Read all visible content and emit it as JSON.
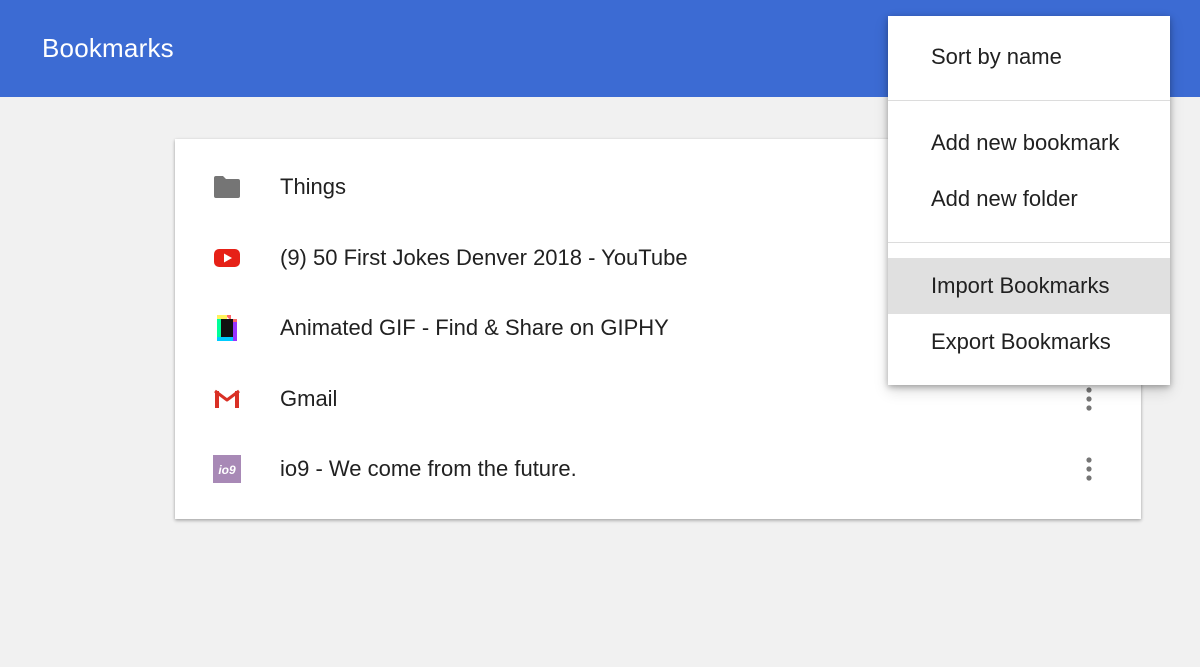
{
  "header": {
    "title": "Bookmarks",
    "background_color": "#3c6bd3"
  },
  "bookmarks": [
    {
      "title": "Things",
      "icon": "folder-icon",
      "type": "folder"
    },
    {
      "title": "(9) 50 First Jokes Denver 2018 - YouTube",
      "icon": "youtube-favicon"
    },
    {
      "title": "Animated GIF - Find & Share on GIPHY",
      "icon": "giphy-favicon"
    },
    {
      "title": "Gmail",
      "icon": "gmail-favicon"
    },
    {
      "title": "io9 - We come from the future.",
      "icon": "io9-favicon",
      "favicon_text": "io9"
    }
  ],
  "menu": {
    "items": [
      {
        "label": "Sort by name"
      },
      {
        "label": "Add new bookmark"
      },
      {
        "label": "Add new folder"
      },
      {
        "label": "Import Bookmarks",
        "highlighted": true
      },
      {
        "label": "Export Bookmarks"
      }
    ]
  },
  "colors": {
    "youtube_red": "#e62117",
    "gmail_red": "#d93025",
    "io9_purple": "#a889b6",
    "folder_gray": "#757575",
    "menu_highlight": "#e0e0e0"
  }
}
